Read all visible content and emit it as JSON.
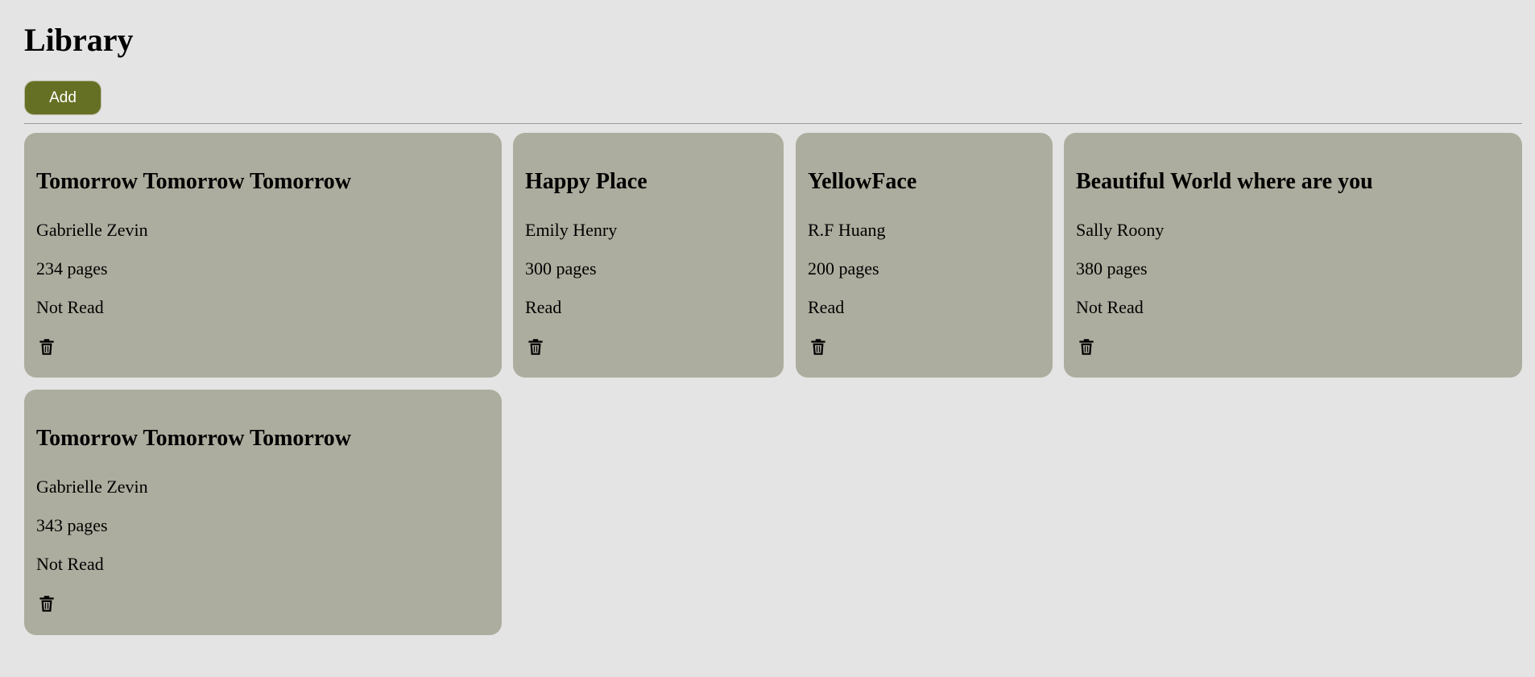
{
  "header": {
    "title": "Library",
    "add_label": "Add"
  },
  "colors": {
    "background": "#e4e4e4",
    "card": "#adad9f",
    "accent": "#667024"
  },
  "books": [
    {
      "title": "Tomorrow Tomorrow Tomorrow",
      "author": "Gabrielle Zevin",
      "pages": "234 pages",
      "status": "Not Read",
      "delete_icon": "trash-icon"
    },
    {
      "title": "Happy Place",
      "author": "Emily Henry",
      "pages": "300 pages",
      "status": "Read",
      "delete_icon": "trash-icon"
    },
    {
      "title": "YellowFace",
      "author": "R.F Huang",
      "pages": "200 pages",
      "status": "Read",
      "delete_icon": "trash-icon"
    },
    {
      "title": "Beautiful World where are you",
      "author": "Sally Roony",
      "pages": "380 pages",
      "status": "Not Read",
      "delete_icon": "trash-icon"
    },
    {
      "title": "Tomorrow Tomorrow Tomorrow",
      "author": "Gabrielle Zevin",
      "pages": "343 pages",
      "status": "Not Read",
      "delete_icon": "trash-icon"
    }
  ]
}
